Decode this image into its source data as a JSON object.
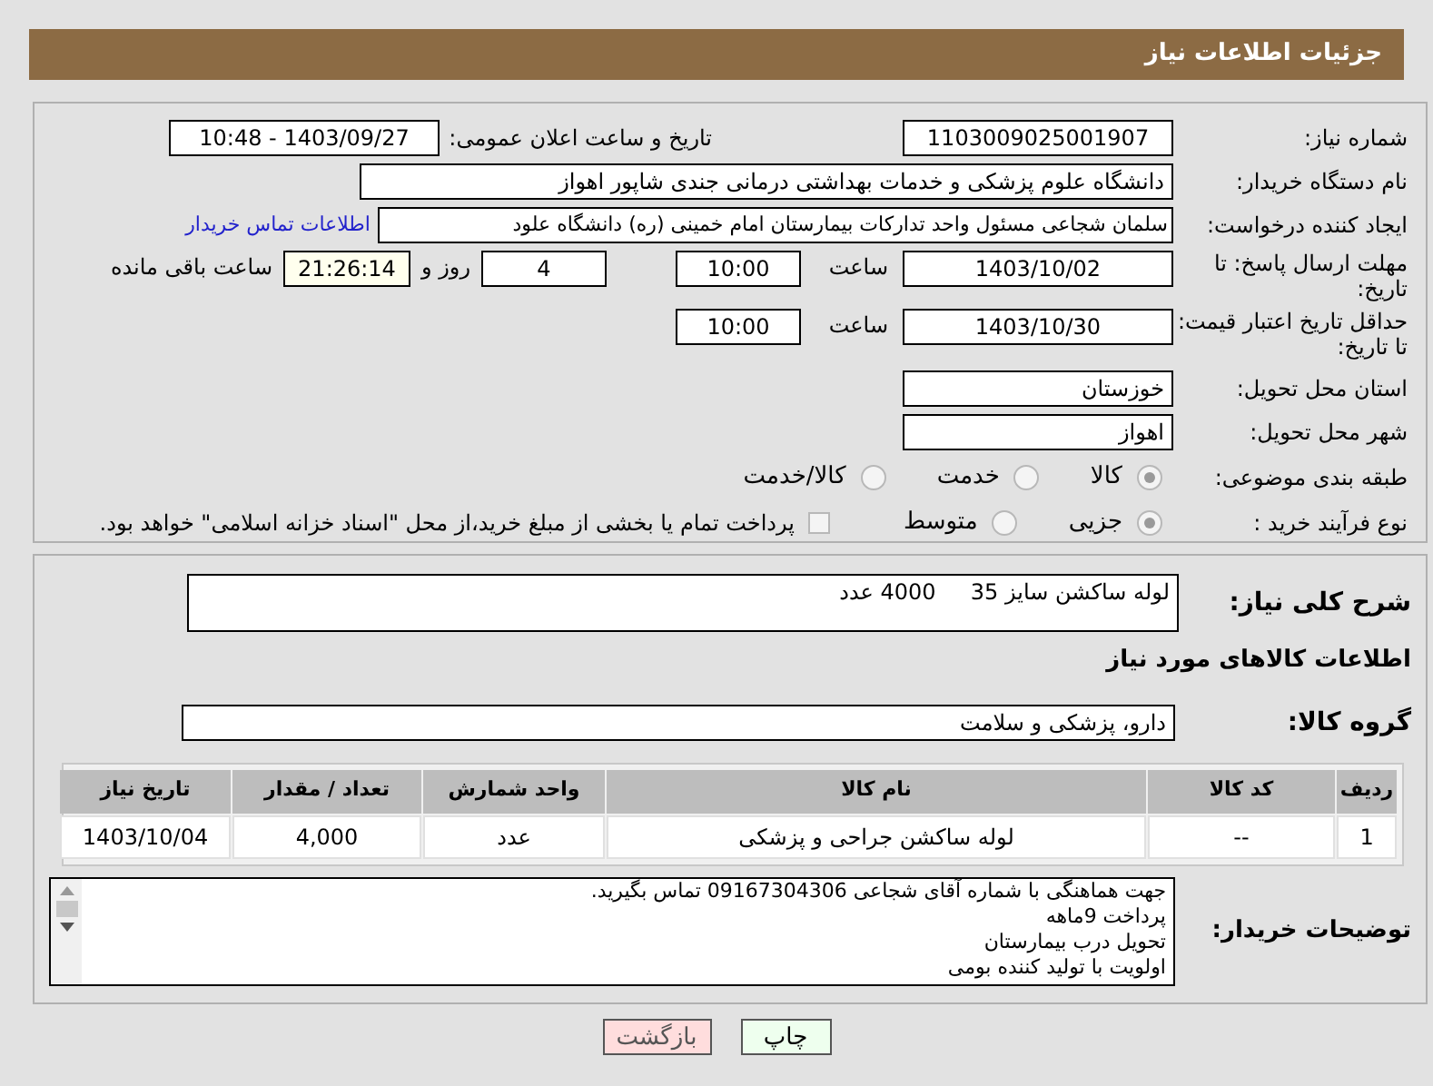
{
  "page_title": "جزئیات اطلاعات نیاز",
  "need_number": {
    "label": "شماره نیاز:",
    "value": "1103009025001907"
  },
  "announce": {
    "label": "تاریخ و ساعت اعلان عمومی:",
    "value": "1403/09/27 - 10:48"
  },
  "buyer_org": {
    "label": "نام دستگاه خریدار:",
    "value": "دانشگاه علوم پزشکی و خدمات بهداشتی درمانی جندی شاپور اهواز"
  },
  "requester": {
    "label": "ایجاد کننده درخواست:",
    "value": "سلمان شجاعی مسئول واحد تدارکات بیمارستان امام خمینی (ره) دانشگاه علود",
    "link": "اطلاعات تماس خریدار"
  },
  "response_deadline": {
    "label": "مهلت ارسال پاسخ: تا تاریخ:",
    "date": "1403/10/02",
    "time_label": "ساعت",
    "time": "10:00",
    "days": "4",
    "days_label": "روز و",
    "remaining": "21:26:14",
    "remaining_label": "ساعت باقی مانده"
  },
  "price_validity": {
    "label": "حداقل تاریخ اعتبار قیمت: تا تاریخ:",
    "date": "1403/10/30",
    "time_label": "ساعت",
    "time": "10:00"
  },
  "province": {
    "label": "استان محل تحویل:",
    "value": "خوزستان"
  },
  "city": {
    "label": "شهر محل تحویل:",
    "value": "اهواز"
  },
  "category": {
    "label": "طبقه بندی موضوعی:",
    "options": [
      {
        "label": "کالا",
        "selected": true
      },
      {
        "label": "خدمت",
        "selected": false
      },
      {
        "label": "کالا/خدمت",
        "selected": false
      }
    ]
  },
  "purchase_process": {
    "label": "نوع فرآیند خرید :",
    "options": [
      {
        "label": "جزیی",
        "selected": true
      },
      {
        "label": "متوسط",
        "selected": false
      }
    ],
    "treasury": {
      "label": "پرداخت تمام یا بخشی از مبلغ خرید،از محل \"اسناد خزانه اسلامی\" خواهد بود.",
      "checked": false
    }
  },
  "description": {
    "label": "شرح کلی نیاز:",
    "value": "لوله ساکشن سایز 35     4000 عدد"
  },
  "goods_heading": "اطلاعات کالاهای مورد نیاز",
  "goods_group": {
    "label": "گروه کالا:",
    "value": "دارو، پزشکی و سلامت"
  },
  "table": {
    "columns": [
      "ردیف",
      "کد کالا",
      "نام کالا",
      "واحد شمارش",
      "تعداد / مقدار",
      "تاریخ نیاز"
    ],
    "rows": [
      [
        "1",
        "--",
        "لوله ساکشن جراحی و پزشکی",
        "عدد",
        "4,000",
        "1403/10/04"
      ]
    ]
  },
  "buyer_notes": {
    "label": "توضیحات خریدار:",
    "lines": [
      "جهت هماهنگی با شماره  آقای شجاعی 09167304306 تماس بگیرید.",
      "پرداخت 9ماهه",
      "تحویل درب بیمارستان",
      "اولویت با تولید کننده بومی"
    ]
  },
  "buttons": [
    {
      "label": "چاپ",
      "kind": "print"
    },
    {
      "label": "بازگشت",
      "kind": "back"
    }
  ]
}
